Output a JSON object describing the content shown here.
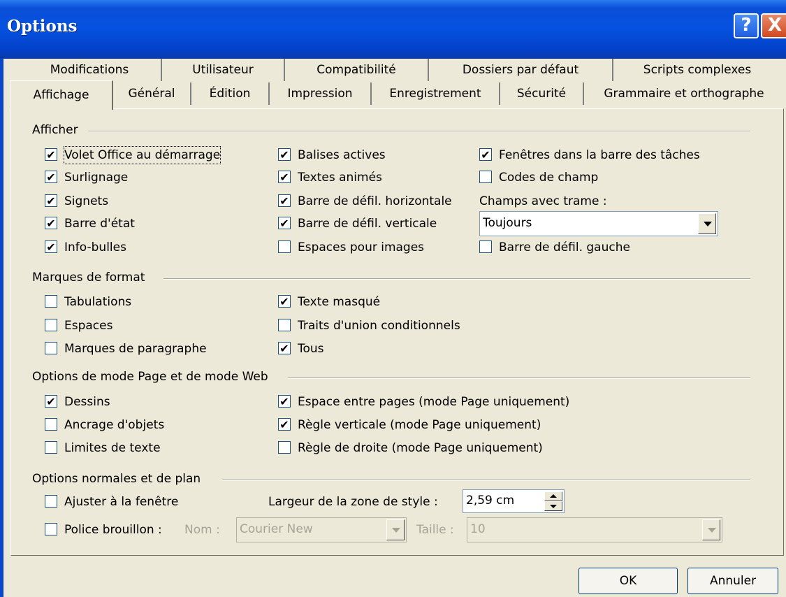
{
  "window": {
    "title": "Options",
    "help_glyph": "?",
    "close_glyph": "X"
  },
  "tabs_back": [
    "Modifications",
    "Utilisateur",
    "Compatibilité",
    "Dossiers par défaut",
    "Scripts complexes"
  ],
  "tabs_front": [
    "Affichage",
    "Général",
    "Édition",
    "Impression",
    "Enregistrement",
    "Sécurité",
    "Grammaire et orthographe"
  ],
  "sections": {
    "afficher": "Afficher",
    "marques": "Marques de format",
    "page_web": "Options de mode Page et de mode Web",
    "normales": "Options normales et de plan"
  },
  "checkboxes": {
    "volet": {
      "label": "Volet Office au démarrage",
      "checked": true
    },
    "surlignage": {
      "label": "Surlignage",
      "checked": true
    },
    "signets": {
      "label": "Signets",
      "checked": true
    },
    "barre_etat": {
      "label": "Barre d'état",
      "checked": true
    },
    "info_bulles": {
      "label": "Info-bulles",
      "checked": true
    },
    "balises": {
      "label": "Balises actives",
      "checked": true
    },
    "textes_animes": {
      "label": "Textes animés",
      "checked": true
    },
    "barre_horiz": {
      "label": "Barre de défil. horizontale",
      "checked": true
    },
    "barre_vert": {
      "label": "Barre de défil. verticale",
      "checked": true
    },
    "espaces_images": {
      "label": "Espaces pour images",
      "checked": false
    },
    "fenetres": {
      "label": "Fenêtres dans la barre des tâches",
      "checked": true
    },
    "codes_champ": {
      "label": "Codes de champ",
      "checked": false
    },
    "barre_gauche": {
      "label": "Barre de défil. gauche",
      "checked": false
    },
    "tabulations": {
      "label": "Tabulations",
      "checked": false
    },
    "espaces": {
      "label": "Espaces",
      "checked": false
    },
    "paragraphe": {
      "label": "Marques de paragraphe",
      "checked": false
    },
    "texte_masque": {
      "label": "Texte masqué",
      "checked": true
    },
    "traits_union": {
      "label": "Traits d'union conditionnels",
      "checked": false
    },
    "tous": {
      "label": "Tous",
      "checked": true
    },
    "dessins": {
      "label": "Dessins",
      "checked": true
    },
    "ancrage": {
      "label": "Ancrage d'objets",
      "checked": false
    },
    "limites": {
      "label": "Limites de texte",
      "checked": false
    },
    "espace_pages": {
      "label": "Espace entre pages (mode Page uniquement)",
      "checked": true
    },
    "regle_vert": {
      "label": "Règle verticale (mode Page uniquement)",
      "checked": true
    },
    "regle_droite": {
      "label": "Règle de droite (mode Page uniquement)",
      "checked": false
    },
    "ajuster": {
      "label": "Ajuster à la fenêtre",
      "checked": false
    },
    "police": {
      "label": "Police brouillon :",
      "checked": false
    }
  },
  "champs_trame": {
    "label": "Champs avec trame :",
    "value": "Toujours"
  },
  "style_zone": {
    "label": "Largeur de la zone de style :",
    "value": "2,59 cm"
  },
  "font": {
    "nom_label": "Nom :",
    "nom_value": "Courier New",
    "taille_label": "Taille :",
    "taille_value": "10"
  },
  "buttons": {
    "ok": "OK",
    "annuler": "Annuler"
  },
  "colors": {
    "titlebar": "#0552e0",
    "dialog_bg": "#ece9d8",
    "close": "#d2481f"
  }
}
